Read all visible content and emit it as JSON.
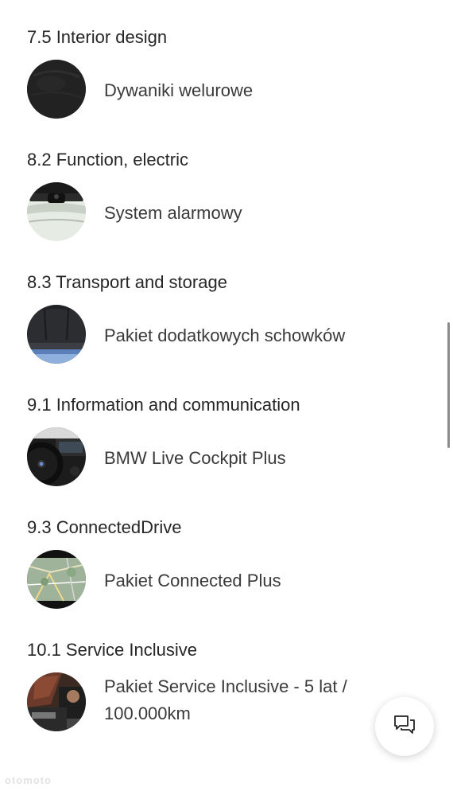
{
  "sections": [
    {
      "title": "7.5 Interior design",
      "item": {
        "label": "Dywaniki welurowe",
        "thumb": "velour-mat-thumbnail"
      }
    },
    {
      "title": "8.2 Function, electric",
      "item": {
        "label": "System alarmowy",
        "thumb": "alarm-system-thumbnail"
      }
    },
    {
      "title": "8.3 Transport and storage",
      "item": {
        "label": "Pakiet dodatkowych schowków",
        "thumb": "storage-package-thumbnail"
      }
    },
    {
      "title": "9.1 Information and communication",
      "item": {
        "label": "BMW Live Cockpit Plus",
        "thumb": "cockpit-thumbnail"
      }
    },
    {
      "title": "9.3 ConnectedDrive",
      "item": {
        "label": "Pakiet Connected Plus",
        "thumb": "navigation-map-thumbnail"
      }
    },
    {
      "title": "10.1 Service Inclusive",
      "item": {
        "label": "Pakiet Service Inclusive - 5 lat / 100.000km",
        "thumb": "service-mechanic-thumbnail"
      }
    }
  ],
  "chat_button": {
    "icon": "chat-bubbles-icon"
  },
  "watermark": "otomoto",
  "colors": {
    "text": "#262626",
    "label": "#3a3a3a",
    "background": "#ffffff",
    "scrollbar": "#8a8a8a"
  }
}
